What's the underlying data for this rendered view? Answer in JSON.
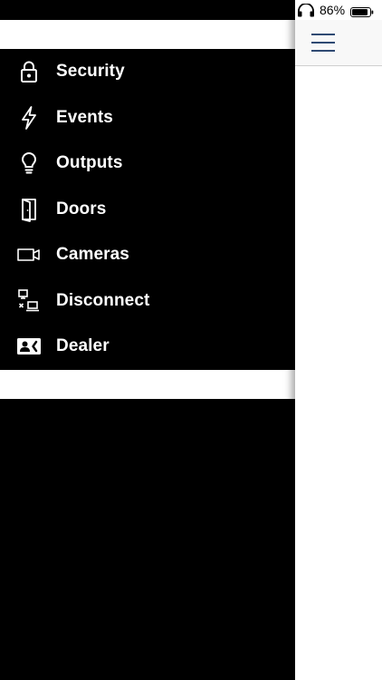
{
  "status_bar": {
    "battery_percent": "86%",
    "headphones_icon": "headphones-icon",
    "battery_icon": "battery-icon"
  },
  "colors": {
    "menu_background": "#000000",
    "menu_text": "#ffffff",
    "hamburger": "#2f4a73"
  },
  "nav_header": {
    "menu_icon": "hamburger-menu-icon"
  },
  "menu": {
    "items": [
      {
        "label": "Security",
        "icon": "lock-icon"
      },
      {
        "label": "Events",
        "icon": "lightning-bolt-icon"
      },
      {
        "label": "Outputs",
        "icon": "lightbulb-icon"
      },
      {
        "label": "Doors",
        "icon": "door-icon"
      },
      {
        "label": "Cameras",
        "icon": "video-camera-icon"
      },
      {
        "label": "Disconnect",
        "icon": "disconnect-network-icon"
      },
      {
        "label": "Dealer",
        "icon": "contact-card-icon"
      }
    ]
  }
}
